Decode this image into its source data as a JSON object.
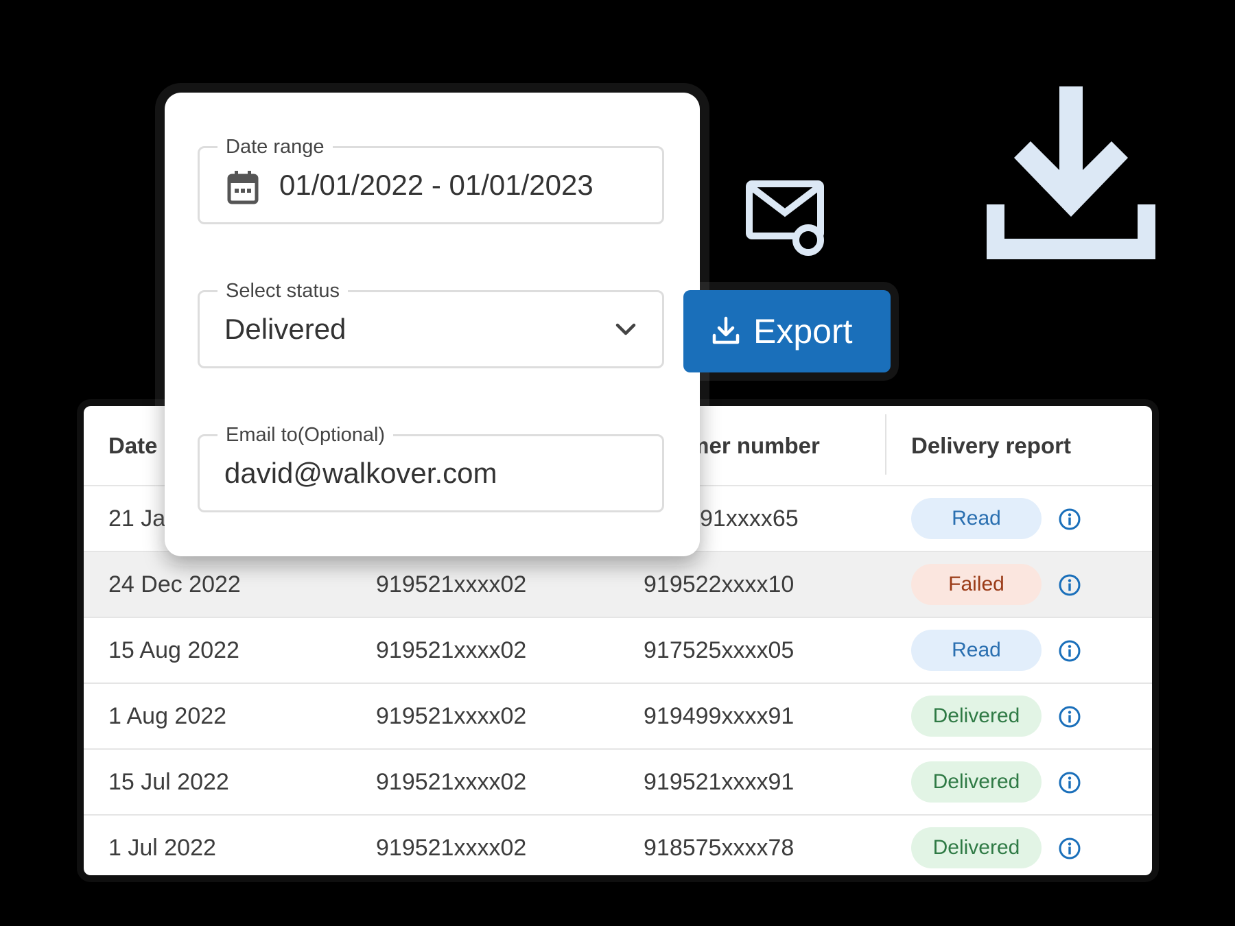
{
  "export_dialog": {
    "date_range": {
      "label": "Date range",
      "value": "01/01/2022 - 01/01/2023",
      "icon": "calendar-icon"
    },
    "status": {
      "label": "Select status",
      "value": "Delivered",
      "icon": "chevron-down-icon"
    },
    "email": {
      "label": "Email to(Optional)",
      "value": "david@walkover.com"
    }
  },
  "export_button": {
    "label": "Export",
    "icon": "download-icon",
    "color": "#1a6fba"
  },
  "decorations": {
    "mail_icon": "mail-link-icon",
    "download_icon": "download-icon",
    "color": "#dce8f5"
  },
  "table": {
    "headers": [
      "Date",
      "omer number",
      "Delivery report"
    ],
    "rows": [
      {
        "date": "21 Ja",
        "sender": "",
        "customer": "91xxxx65",
        "status": "Read"
      },
      {
        "date": "24 Dec 2022",
        "sender": "919521xxxx02",
        "customer": "919522xxxx10",
        "status": "Failed"
      },
      {
        "date": "15 Aug 2022",
        "sender": "919521xxxx02",
        "customer": "917525xxxx05",
        "status": "Read"
      },
      {
        "date": "1 Aug 2022",
        "sender": "919521xxxx02",
        "customer": "919499xxxx91",
        "status": "Delivered"
      },
      {
        "date": "15 Jul 2022",
        "sender": "919521xxxx02",
        "customer": "919521xxxx91",
        "status": "Delivered"
      },
      {
        "date": "1 Jul 2022",
        "sender": "919521xxxx02",
        "customer": "918575xxxx78",
        "status": "Delivered"
      }
    ],
    "status_colors": {
      "Read": {
        "bg": "#e2eefb",
        "fg": "#2a6fb0"
      },
      "Failed": {
        "bg": "#fbe6df",
        "fg": "#9a3a16"
      },
      "Delivered": {
        "bg": "#e2f4e5",
        "fg": "#2f7a45"
      }
    },
    "info_icon": "info-icon"
  }
}
